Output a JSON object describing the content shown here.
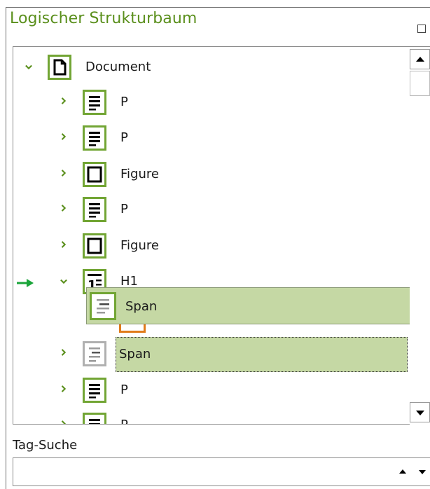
{
  "panel": {
    "title": "Logischer Strukturbaum"
  },
  "tree": {
    "rows": [
      {
        "label": "Document",
        "icon": "document-icon",
        "state": "expanded"
      },
      {
        "label": "P",
        "icon": "paragraph-icon",
        "state": "collapsed"
      },
      {
        "label": "P",
        "icon": "paragraph-icon",
        "state": "collapsed"
      },
      {
        "label": "Figure",
        "icon": "figure-icon",
        "state": "collapsed"
      },
      {
        "label": "P",
        "icon": "paragraph-icon",
        "state": "collapsed"
      },
      {
        "label": "Figure",
        "icon": "figure-icon",
        "state": "collapsed"
      },
      {
        "label": "H1",
        "icon": "heading1-icon",
        "state": "expanded"
      },
      {
        "label": "Span",
        "icon": "span-icon",
        "state": "collapsed"
      },
      {
        "label": "P",
        "icon": "paragraph-icon",
        "state": "collapsed"
      },
      {
        "label": "P",
        "icon": "paragraph-icon",
        "state": "collapsed"
      }
    ],
    "drag_ghost_label": "Span",
    "selected_row_label": "Span"
  },
  "search": {
    "label": "Tag-Suche",
    "value": ""
  },
  "colors": {
    "accent": "#5a8f1c",
    "icon_border": "#72a534",
    "selection": "#c5d8a4",
    "drop_arrow": "#1aa53a"
  }
}
